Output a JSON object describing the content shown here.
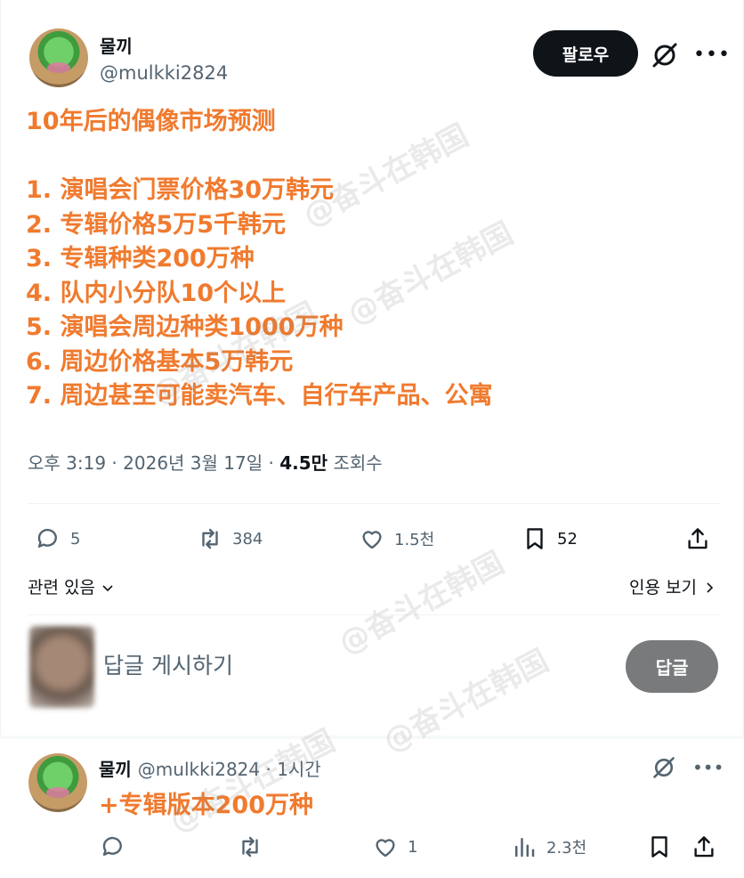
{
  "author": {
    "name": "물끼",
    "handle": "@mulkki2824"
  },
  "follow_label": "팔로우",
  "post": {
    "title": "10年后的偶像市场预测",
    "items": [
      "1. 演唱会门票价格30万韩元",
      "2. 专辑价格5万5千韩元",
      "3. 专辑种类200万种",
      "4. 队内小分队10个以上",
      "5. 演唱会周边种类1000万种",
      "6. 周边价格基本5万韩元",
      "7. 周边甚至可能卖汽车、自行车产品、公寓"
    ]
  },
  "meta": {
    "time": "오후 3:19",
    "date": "2026년 3월 17일",
    "views_count": "4.5만",
    "views_label": "조회수"
  },
  "actions": {
    "replies": "5",
    "reposts": "384",
    "likes": "1.5천",
    "bookmarks": "52"
  },
  "related_label": "관련 있음",
  "quotes_label": "인용 보기",
  "reply_box": {
    "placeholder": "답글 게시하기",
    "button": "답글"
  },
  "thread": {
    "name": "물끼",
    "handle_time": "@mulkki2824 · 1시간",
    "text": "+专辑版本200万种",
    "likes": "1",
    "views": "2.3천"
  },
  "watermark": "@奋斗在韩国",
  "colors": {
    "accent_text": "#f07a2e",
    "follow_bg": "#0f1419",
    "reply_btn_bg": "#787a7c",
    "secondary_text": "#536471"
  },
  "icons": [
    "grok-icon",
    "more-icon",
    "reply-icon",
    "repost-icon",
    "like-icon",
    "bookmark-icon",
    "share-icon",
    "chevron-down-icon",
    "chevron-right-icon",
    "views-icon"
  ]
}
